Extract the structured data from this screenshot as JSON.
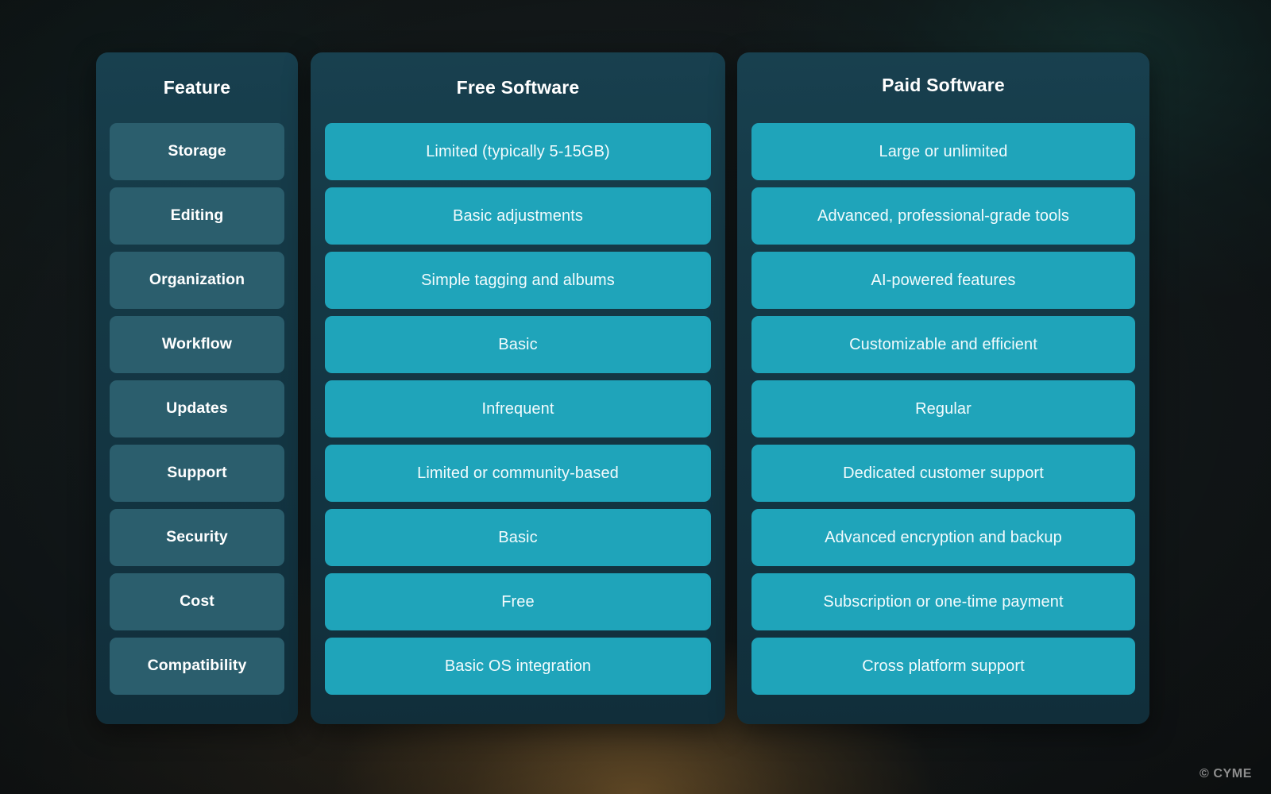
{
  "columns": {
    "feature_header": "Feature",
    "free_header": "Free Software",
    "paid_header": "Paid Software"
  },
  "rows": [
    {
      "feature": "Storage",
      "free": "Limited (typically 5-15GB)",
      "paid": "Large or unlimited"
    },
    {
      "feature": "Editing",
      "free": "Basic adjustments",
      "paid": "Advanced, professional-grade tools"
    },
    {
      "feature": "Organization",
      "free": "Simple tagging and albums",
      "paid": "AI-powered features"
    },
    {
      "feature": "Workflow",
      "free": "Basic",
      "paid": "Customizable and efficient"
    },
    {
      "feature": "Updates",
      "free": "Infrequent",
      "paid": "Regular"
    },
    {
      "feature": "Support",
      "free": "Limited or community-based",
      "paid": "Dedicated customer support"
    },
    {
      "feature": "Security",
      "free": "Basic",
      "paid": "Advanced encryption and backup"
    },
    {
      "feature": "Cost",
      "free": "Free",
      "paid": "Subscription or one-time payment"
    },
    {
      "feature": "Compatibility",
      "free": "Basic OS integration",
      "paid": "Cross platform support"
    }
  ],
  "watermark": "© CYME",
  "colors": {
    "panel_bg": "#153946",
    "feature_cell": "#2b5e6d",
    "value_cell": "#1fa4ba",
    "header_text": "#ffffff",
    "page_bg": "#131818",
    "warm_glow": "#4a3a23",
    "teal_glow": "#183a38"
  }
}
